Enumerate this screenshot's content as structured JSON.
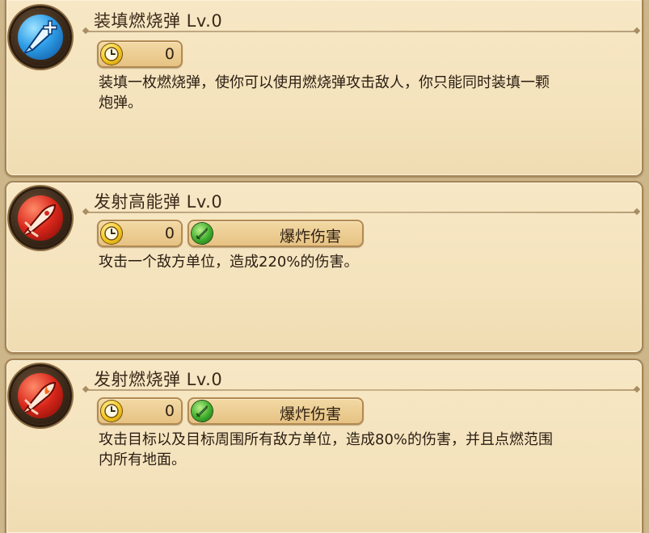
{
  "skills": [
    {
      "title": "装填燃烧弹 Lv.0",
      "icon": "rocket-plus-icon",
      "icon_color": "#2f9ee8",
      "cooldown": "0",
      "tag": null,
      "description": "装填一枚燃烧弹，使你可以使用燃烧弹攻击敌人，你只能同时装填一颗\n炮弹。"
    },
    {
      "title": "发射高能弹 Lv.0",
      "icon": "rocket-icon",
      "icon_color": "#d8261a",
      "cooldown": "0",
      "tag": "爆炸伤害",
      "description": "攻击一个敌方单位，造成220%的伤害。"
    },
    {
      "title": "发射燃烧弹 Lv.0",
      "icon": "fire-rocket-icon",
      "icon_color": "#d8261a",
      "cooldown": "0",
      "tag": "爆炸伤害",
      "description": "攻击目标以及目标周围所有敌方单位，造成80%的伤害，并且点燃范围\n内所有地面。"
    }
  ],
  "colors": {
    "panel_bg": "#f4e3bd",
    "panel_border": "#a58556",
    "text": "#2a1d12",
    "badge_bg": "#e6c283"
  }
}
